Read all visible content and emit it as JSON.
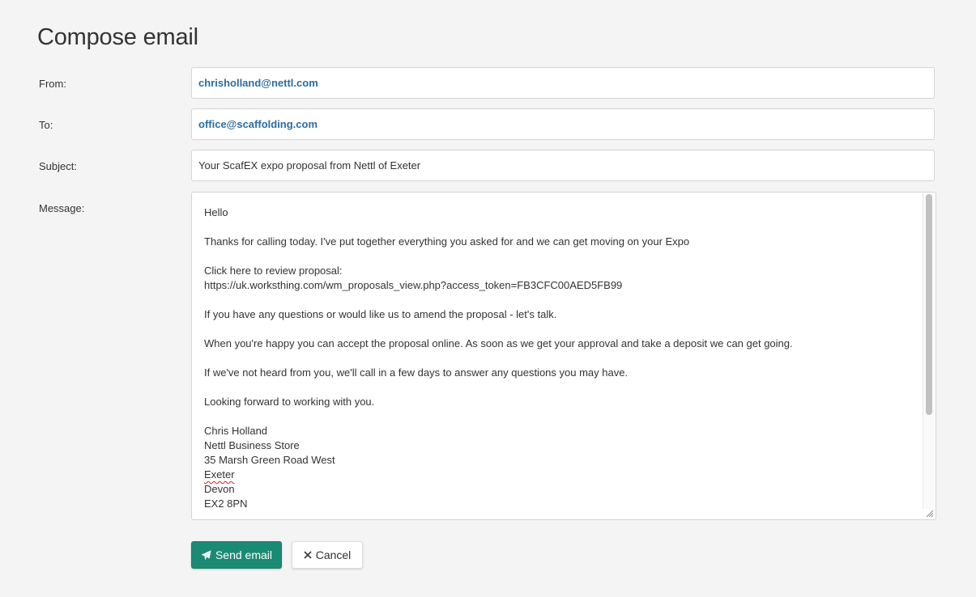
{
  "page": {
    "title": "Compose email"
  },
  "form": {
    "from_label": "From:",
    "from_value": "chrisholland@nettl.com",
    "to_label": "To:",
    "to_value": "office@scaffolding.com",
    "subject_label": "Subject:",
    "subject_value": "Your ScafEX expo proposal from Nettl of Exeter",
    "message_label": "Message:"
  },
  "message": {
    "greeting": "Hello",
    "intro": "Thanks for calling today. I've put together everything you asked for and we can get moving on your Expo",
    "review_prompt": "Click here to review proposal:",
    "review_link": "https://uk.worksthing.com/wm_proposals_view.php?access_token=FB3CFC00AED5FB99",
    "questions": "If you have any questions or would like us to amend the proposal - let's talk.",
    "accept": "When you're happy you can accept the proposal online. As soon as we get your approval and take a deposit we can get going.",
    "follow_up": "If we've not heard from you, we'll call in a few days to answer any questions you may have.",
    "closing": "Looking forward to working with you.",
    "signature": {
      "name": "Chris Holland",
      "company": "Nettl Business Store",
      "street": "35 Marsh Green Road West",
      "city": "Exeter",
      "county": "Devon",
      "postcode": "EX2 8PN"
    }
  },
  "actions": {
    "send_label": "Send email",
    "send_icon": "paper-plane-icon",
    "cancel_label": "Cancel",
    "cancel_icon": "close-icon"
  },
  "colors": {
    "accent": "#1b8a75",
    "email_text": "#2d6ca2",
    "background": "#f4f4f4"
  }
}
